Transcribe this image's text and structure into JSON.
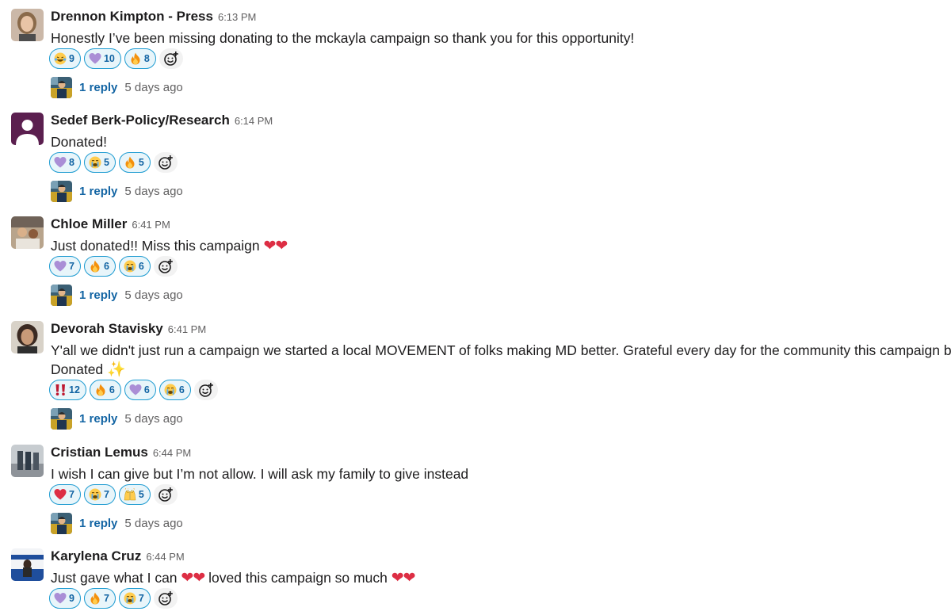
{
  "messages": [
    {
      "author": "Drennon Kimpton - Press",
      "time": "6:13 PM",
      "text": "Honestly I’ve been missing donating to the mckayla campaign so thank you for this opportunity!",
      "reactions": [
        {
          "emoji": "laughing-crying-emoji",
          "count": "9"
        },
        {
          "emoji": "purple-heart-emoji",
          "count": "10"
        },
        {
          "emoji": "fire-emoji",
          "count": "8"
        }
      ],
      "reply": {
        "count_label": "1 reply",
        "time": "5 days ago"
      }
    },
    {
      "author": "Sedef Berk-Policy/Research",
      "time": "6:14 PM",
      "text": "Donated!",
      "reactions": [
        {
          "emoji": "purple-heart-emoji",
          "count": "8"
        },
        {
          "emoji": "loudly-crying-emoji",
          "count": "5"
        },
        {
          "emoji": "fire-emoji",
          "count": "5"
        }
      ],
      "reply": {
        "count_label": "1 reply",
        "time": "5 days ago"
      }
    },
    {
      "author": "Chloe Miller",
      "time": "6:41 PM",
      "text": "Just donated!! Miss this campaign",
      "text_emoji": "❤❤",
      "reactions": [
        {
          "emoji": "purple-heart-emoji",
          "count": "7"
        },
        {
          "emoji": "fire-emoji",
          "count": "6"
        },
        {
          "emoji": "loudly-crying-emoji",
          "count": "6"
        }
      ],
      "reply": {
        "count_label": "1 reply",
        "time": "5 days ago"
      }
    },
    {
      "author": "Devorah Stavisky",
      "time": "6:41 PM",
      "text": "Y'all we didn't just run a campaign we started a local MOVEMENT of folks making MD better. Grateful every day for the community this campaign built.",
      "text_line2": "Donated",
      "text_emoji": "✨",
      "reactions": [
        {
          "emoji": "double-exclamation-emoji",
          "count": "12"
        },
        {
          "emoji": "fire-emoji",
          "count": "6"
        },
        {
          "emoji": "purple-heart-emoji",
          "count": "6"
        },
        {
          "emoji": "loudly-crying-emoji",
          "count": "6"
        }
      ],
      "reply": {
        "count_label": "1 reply",
        "time": "5 days ago"
      }
    },
    {
      "author": "Cristian Lemus",
      "time": "6:44 PM",
      "text": "I wish I can give but I’m not allow. I will ask my family to give instead",
      "reactions": [
        {
          "emoji": "red-heart-emoji",
          "count": "7"
        },
        {
          "emoji": "loudly-crying-emoji",
          "count": "7"
        },
        {
          "emoji": "raising-hands-emoji",
          "count": "5"
        }
      ],
      "reply": {
        "count_label": "1 reply",
        "time": "5 days ago"
      }
    },
    {
      "author": "Karylena Cruz",
      "time": "6:44 PM",
      "text": "Just gave what I can",
      "text_emoji": "❤❤",
      "text_mid": "loved this campaign so much",
      "text_emoji2": "❤❤",
      "reactions": [
        {
          "emoji": "purple-heart-emoji",
          "count": "9"
        },
        {
          "emoji": "fire-emoji",
          "count": "7"
        },
        {
          "emoji": "loudly-crying-emoji",
          "count": "7"
        }
      ]
    }
  ],
  "colors": {
    "link_blue": "#1264a3",
    "reaction_border": "#1d9bd1",
    "reaction_bg": "#e8f5fa",
    "muted_text": "#616061"
  }
}
